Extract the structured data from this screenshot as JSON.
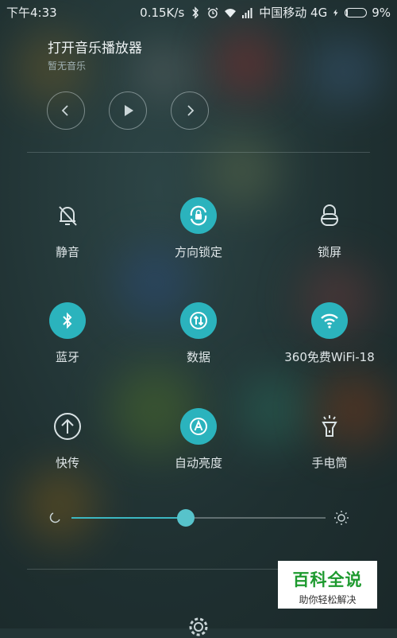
{
  "status_bar": {
    "time": "下午4:33",
    "net_speed": "0.15K/s",
    "carrier": "中国移动 4G",
    "battery_percent": "9%",
    "battery_level": 0.09
  },
  "music": {
    "title": "打开音乐播放器",
    "subtitle": "暂无音乐"
  },
  "toggles": [
    {
      "label": "静音",
      "icon": "bell-off-icon",
      "active": false
    },
    {
      "label": "方向锁定",
      "icon": "rotation-lock-icon",
      "active": true
    },
    {
      "label": "锁屏",
      "icon": "lock-icon",
      "active": false
    },
    {
      "label": "蓝牙",
      "icon": "bluetooth-icon",
      "active": true
    },
    {
      "label": "数据",
      "icon": "mobile-data-icon",
      "active": true
    },
    {
      "label": "360免费WiFi-18",
      "icon": "wifi-icon",
      "active": true
    },
    {
      "label": "快传",
      "icon": "upload-icon",
      "active": false
    },
    {
      "label": "自动亮度",
      "icon": "auto-brightness-icon",
      "active": true
    },
    {
      "label": "手电筒",
      "icon": "flashlight-icon",
      "active": false
    }
  ],
  "brightness": {
    "level": 0.45
  },
  "accent_color": "#2bb3bd",
  "watermark": {
    "title": "百科全说",
    "subtitle": "助你轻松解决"
  }
}
